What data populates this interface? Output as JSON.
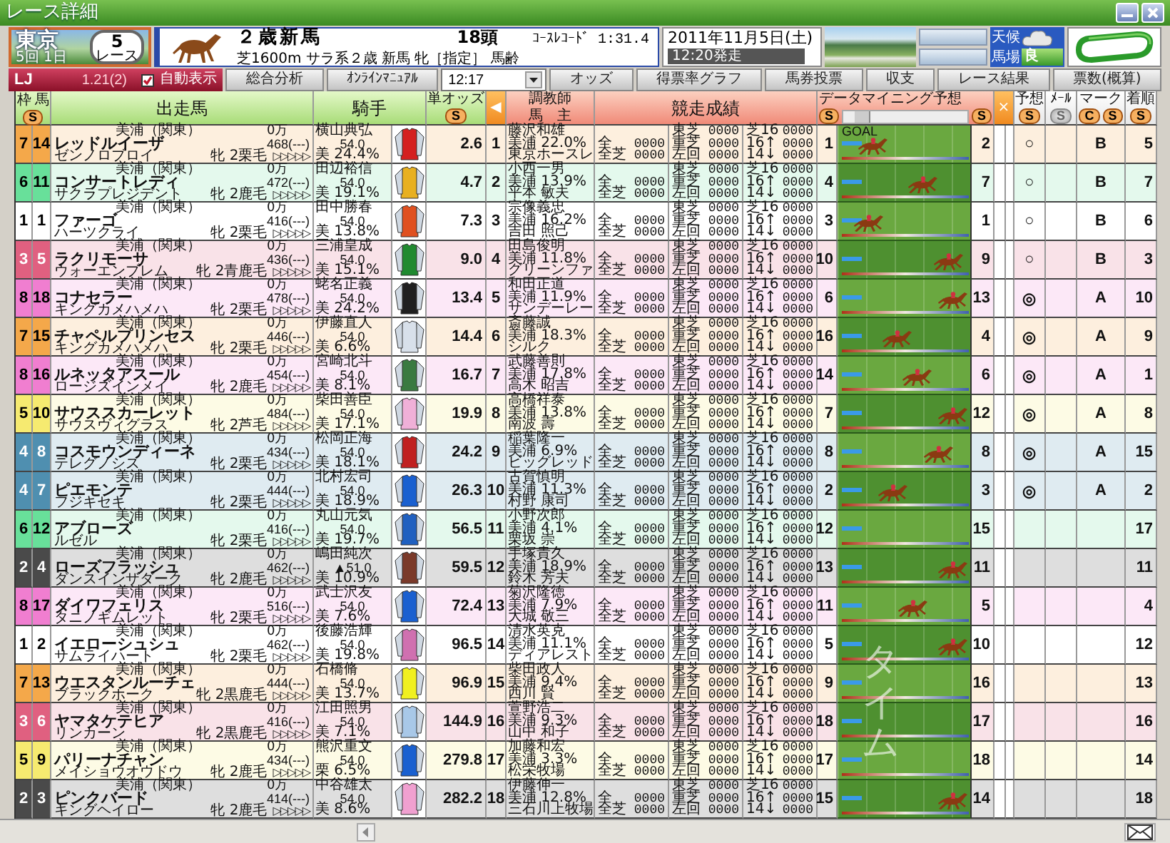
{
  "window": {
    "title": "レース詳細"
  },
  "venue": {
    "name": "東京",
    "meeting": "5回 1日",
    "race_no": "5",
    "race_label": "レース"
  },
  "race": {
    "name": "２歳新馬",
    "conditions": "芝1600m サラ系２歳 新馬 牝［指定］ 馬齢",
    "runners": "18頭",
    "course_record": "ｺｰｽﾚｺｰﾄﾞ 1:31.4",
    "date": "2011年11月5日(土)",
    "post_time": "12:20発走"
  },
  "conditions": {
    "weather_label": "天候",
    "track_label": "馬場",
    "track_state": "良"
  },
  "toolbar": {
    "badge": "LJ",
    "value": "1.21(2)",
    "auto_display": {
      "label": "自動表示",
      "checked": true
    },
    "items": [
      {
        "kind": "button",
        "label": "総合分析"
      },
      {
        "kind": "button",
        "label": "ｵﾝﾗｲﾝﾏﾆｭｱﾙ"
      },
      {
        "kind": "select",
        "label": "12:17"
      },
      {
        "kind": "button",
        "label": "オッズ"
      },
      {
        "kind": "button",
        "label": "得票率グラフ"
      },
      {
        "kind": "button",
        "label": "馬券投票"
      },
      {
        "kind": "button",
        "label": "収支"
      },
      {
        "kind": "button",
        "label": "レース結果"
      },
      {
        "kind": "button",
        "label": "票数(概算)"
      }
    ]
  },
  "header": {
    "frame": "枠",
    "number": "馬",
    "frame_sort": "S",
    "horse": "出走馬",
    "jockey": "騎手",
    "odds": {
      "label": "単オッズ",
      "sort": "S"
    },
    "collapse": "◀",
    "trainer": "調教師",
    "owner": "馬　主",
    "record": "競走成績",
    "mining": {
      "label": "データマイニング予想",
      "sort_left": "S",
      "sort_right": "S"
    },
    "close": "×",
    "forecast": {
      "label": "予想",
      "sort": "S",
      "disabled": false
    },
    "mail": {
      "label": "ﾒｰﾙ",
      "sort": "S",
      "disabled": true
    },
    "mark": {
      "label": "マーク",
      "buttons": [
        "C",
        "S"
      ]
    },
    "finish": {
      "label": "着順",
      "sort": "S",
      "disabled": false
    }
  },
  "goal_label": "GOAL",
  "track_overlay": "タイム",
  "rows": [
    {
      "frame": "7",
      "number": "14",
      "color": "#f4a84a",
      "stable": "美浦（関東）",
      "prize": "0万",
      "name": "レッドルイーザ",
      "weight": "468(---)",
      "sire": "ゼンノロブロイ",
      "sex_coat": "牝 2栗毛",
      "pace": "▷▷▷▷▷",
      "jockey": "横山典弘",
      "jockey_weight": "54.0",
      "jockey_rate": "美 24.4%",
      "silks": {
        "color": "#d42020"
      },
      "odds": "2.6",
      "popularity": "1",
      "trainer": "藤沢和雄",
      "trainer_rate": "美浦 22.0%",
      "owner": "東京ホースレ",
      "records": [
        [
          "全",
          "0000"
        ],
        [
          "全芝",
          "0000"
        ],
        [
          "東芝",
          "0000"
        ],
        [
          "重芝",
          "0000"
        ],
        [
          "左回",
          "0000"
        ],
        [
          "芝16",
          "0000"
        ],
        [
          "16↑",
          "0000"
        ],
        [
          "14↓",
          "0000"
        ]
      ],
      "mining_rank": "1",
      "level": 0.2,
      "predicted": "2",
      "forecast": "○",
      "mark": "B",
      "finish": "5"
    },
    {
      "frame": "6",
      "number": "11",
      "color": "#68e09a",
      "stable": "美浦（関東）",
      "prize": "0万",
      "name": "コンサートレディ",
      "weight": "472(---)",
      "sire": "サクラプレジデント",
      "sex_coat": "牝 2鹿毛",
      "pace": "▷▷▷▷▷",
      "jockey": "田辺裕信",
      "jockey_weight": "54.0",
      "jockey_rate": "美 19.1%",
      "silks": {
        "color": "#e8b020"
      },
      "odds": "4.7",
      "popularity": "2",
      "trainer": "小西一男",
      "trainer_rate": "美浦 13.9%",
      "owner": "平本 敏夫",
      "records": [
        [
          "全",
          "0000"
        ],
        [
          "全芝",
          "0000"
        ],
        [
          "東芝",
          "0000"
        ],
        [
          "重芝",
          "0000"
        ],
        [
          "左回",
          "0000"
        ],
        [
          "芝16",
          "0000"
        ],
        [
          "16↑",
          "0000"
        ],
        [
          "14↓",
          "0000"
        ]
      ],
      "mining_rank": "4",
      "level": 0.7,
      "predicted": "7",
      "forecast": "○",
      "mark": "B",
      "finish": "7"
    },
    {
      "frame": "1",
      "number": "1",
      "color": "#ffffff",
      "stable": "美浦（関東）",
      "prize": "0万",
      "name": "ファーゴ",
      "weight": "416(---)",
      "sire": "ハーツクライ",
      "sex_coat": "牝 2栗毛",
      "pace": "▷▷▷▷▷",
      "jockey": "田中勝春",
      "jockey_weight": "54.0",
      "jockey_rate": "美 13.8%",
      "silks": {
        "color": "#e05020"
      },
      "odds": "7.3",
      "popularity": "3",
      "trainer": "宗像義忠",
      "trainer_rate": "美浦 16.2%",
      "owner": "吉田 照己",
      "records": [
        [
          "全",
          "0000"
        ],
        [
          "全芝",
          "0000"
        ],
        [
          "東芝",
          "0000"
        ],
        [
          "重芝",
          "0000"
        ],
        [
          "左回",
          "0000"
        ],
        [
          "芝16",
          "0000"
        ],
        [
          "16↑",
          "0000"
        ],
        [
          "14↓",
          "0000"
        ]
      ],
      "mining_rank": "3",
      "level": 0.15,
      "predicted": "1",
      "forecast": "○",
      "mark": "B",
      "finish": "6"
    },
    {
      "frame": "3",
      "number": "5",
      "color": "#e06080",
      "stable": "美浦（関東）",
      "prize": "0万",
      "name": "ラクリモーサ",
      "weight": "436(---)",
      "sire": "ウォーエンブレム",
      "sex_coat": "牝 2青鹿毛",
      "pace": "▷▷▷▷▷",
      "jockey": "三浦皇成",
      "jockey_weight": "54.0",
      "jockey_rate": "美 15.1%",
      "silks": {
        "color": "#208a30"
      },
      "odds": "9.0",
      "popularity": "4",
      "trainer": "田島俊明",
      "trainer_rate": "美浦 11.8%",
      "owner": "グリーンファ",
      "records": [
        [
          "全",
          "0000"
        ],
        [
          "全芝",
          "0000"
        ],
        [
          "東芝",
          "0000"
        ],
        [
          "重芝",
          "0000"
        ],
        [
          "左回",
          "0000"
        ],
        [
          "芝16",
          "0000"
        ],
        [
          "16↑",
          "0000"
        ],
        [
          "14↓",
          "0000"
        ]
      ],
      "mining_rank": "10",
      "level": 0.95,
      "predicted": "9",
      "forecast": "○",
      "mark": "B",
      "finish": "3"
    },
    {
      "frame": "8",
      "number": "18",
      "color": "#f07ed0",
      "stable": "美浦（関東）",
      "prize": "0万",
      "name": "コナセラー",
      "weight": "478(---)",
      "sire": "キングカメハメハ",
      "sex_coat": "牝 2栗毛",
      "pace": "▷▷▷▷▷",
      "jockey": "蛯名正義",
      "jockey_weight": "54.0",
      "jockey_rate": "美 24.2%",
      "silks": {
        "color": "#202020"
      },
      "odds": "13.4",
      "popularity": "5",
      "trainer": "和田正道",
      "trainer_rate": "美浦 11.9%",
      "owner": "サンデーレー",
      "records": [
        [
          "全",
          "0000"
        ],
        [
          "全芝",
          "0000"
        ],
        [
          "東芝",
          "0000"
        ],
        [
          "重芝",
          "0000"
        ],
        [
          "左回",
          "0000"
        ],
        [
          "芝16",
          "0000"
        ],
        [
          "16↑",
          "0000"
        ],
        [
          "14↓",
          "0000"
        ]
      ],
      "mining_rank": "6",
      "level": 1,
      "predicted": "13",
      "forecast": "◎",
      "mark": "A",
      "finish": "10"
    },
    {
      "frame": "7",
      "number": "15",
      "color": "#f4a84a",
      "stable": "美浦（関東）",
      "prize": "0万",
      "name": "チャペルプリンセス",
      "weight": "446(---)",
      "sire": "キングカメハメハ",
      "sex_coat": "牝 2栗毛",
      "pace": "▷▷▷▷▷",
      "jockey": "伊藤直人",
      "jockey_weight": "54.0",
      "jockey_rate": "美 6.6%",
      "silks": {
        "color": "#d8e0ea"
      },
      "odds": "14.4",
      "popularity": "6",
      "trainer": "斎藤誠",
      "trainer_rate": "美浦 18.3%",
      "owner": "シルク",
      "records": [
        [
          "全",
          "0000"
        ],
        [
          "全芝",
          "0000"
        ],
        [
          "東芝",
          "0000"
        ],
        [
          "重芝",
          "0000"
        ],
        [
          "左回",
          "0000"
        ],
        [
          "芝16",
          "0000"
        ],
        [
          "16↑",
          "0000"
        ],
        [
          "14↓",
          "0000"
        ]
      ],
      "mining_rank": "16",
      "level": 0.45,
      "predicted": "4",
      "forecast": "◎",
      "mark": "A",
      "finish": "9"
    },
    {
      "frame": "8",
      "number": "16",
      "color": "#f07ed0",
      "stable": "美浦（関東）",
      "prize": "0万",
      "name": "ルネッタアスール",
      "weight": "454(---)",
      "sire": "ロージズインメイ",
      "sex_coat": "牝 2鹿毛",
      "pace": "▷▷▷▷▷",
      "jockey": "宮崎北斗",
      "jockey_weight": "54.0",
      "jockey_rate": "美 8.1%",
      "silks": {
        "color": "#3a7a40"
      },
      "odds": "16.7",
      "popularity": "7",
      "trainer": "武藤善則",
      "trainer_rate": "美浦 17.8%",
      "owner": "高木 昭吉",
      "records": [
        [
          "全",
          "0000"
        ],
        [
          "全芝",
          "0000"
        ],
        [
          "東芝",
          "0000"
        ],
        [
          "重芝",
          "0000"
        ],
        [
          "左回",
          "0000"
        ],
        [
          "芝16",
          "0000"
        ],
        [
          "16↑",
          "0000"
        ],
        [
          "14↓",
          "0000"
        ]
      ],
      "mining_rank": "14",
      "level": 0.65,
      "predicted": "6",
      "forecast": "◎",
      "mark": "A",
      "finish": "1"
    },
    {
      "frame": "5",
      "number": "10",
      "color": "#f6ea70",
      "stable": "美浦（関東）",
      "prize": "0万",
      "name": "サウススカーレット",
      "weight": "484(---)",
      "sire": "サウスヴィグラス",
      "sex_coat": "牝 2芦毛",
      "pace": "▷▷▷▷▷",
      "jockey": "柴田善臣",
      "jockey_weight": "54.0",
      "jockey_rate": "美 17.1%",
      "silks": {
        "color": "#f0b0d8"
      },
      "odds": "19.9",
      "popularity": "8",
      "trainer": "高橋祥泰",
      "trainer_rate": "美浦 13.8%",
      "owner": "南波 壽",
      "records": [
        [
          "全",
          "0000"
        ],
        [
          "全芝",
          "0000"
        ],
        [
          "東芝",
          "0000"
        ],
        [
          "重芝",
          "0000"
        ],
        [
          "左回",
          "0000"
        ],
        [
          "芝16",
          "0000"
        ],
        [
          "16↑",
          "0000"
        ],
        [
          "14↓",
          "0000"
        ]
      ],
      "mining_rank": "7",
      "level": 1,
      "predicted": "12",
      "forecast": "◎",
      "mark": "A",
      "finish": "8"
    },
    {
      "frame": "4",
      "number": "8",
      "color": "#4f8fb0",
      "stable": "美浦（関東）",
      "prize": "0万",
      "name": "コスモウンディーネ",
      "weight": "434(---)",
      "sire": "テレグノシス",
      "sex_coat": "牝 2栗毛",
      "pace": "▷▷▷▷▷",
      "jockey": "松岡正海",
      "jockey_weight": "54.0",
      "jockey_rate": "美 18.1%",
      "silks": {
        "color": "#c02020"
      },
      "odds": "24.2",
      "popularity": "9",
      "trainer": "稲葉隆一",
      "trainer_rate": "美浦 6.9%",
      "owner": "ビッグレッド",
      "records": [
        [
          "全",
          "0000"
        ],
        [
          "全芝",
          "0000"
        ],
        [
          "東芝",
          "0000"
        ],
        [
          "重芝",
          "0000"
        ],
        [
          "左回",
          "0000"
        ],
        [
          "芝16",
          "0000"
        ],
        [
          "16↑",
          "0000"
        ],
        [
          "14↓",
          "0000"
        ]
      ],
      "mining_rank": "8",
      "level": 0.85,
      "predicted": "8",
      "forecast": "◎",
      "mark": "A",
      "finish": "15"
    },
    {
      "frame": "4",
      "number": "7",
      "color": "#4f8fb0",
      "stable": "美浦（関東）",
      "prize": "0万",
      "name": "ピエモンテ",
      "weight": "444(---)",
      "sire": "フジキセキ",
      "sex_coat": "牝 2栗毛",
      "pace": "▷▷▷▷▷",
      "jockey": "北村宏司",
      "jockey_weight": "54.0",
      "jockey_rate": "美 18.9%",
      "silks": {
        "color": "#1a60d0"
      },
      "odds": "26.3",
      "popularity": "10",
      "trainer": "古賀慎明",
      "trainer_rate": "美浦 11.3%",
      "owner": "村野 康司",
      "records": [
        [
          "全",
          "0000"
        ],
        [
          "全芝",
          "0000"
        ],
        [
          "東芝",
          "0000"
        ],
        [
          "重芝",
          "0000"
        ],
        [
          "左回",
          "0000"
        ],
        [
          "芝16",
          "0000"
        ],
        [
          "16↑",
          "0000"
        ],
        [
          "14↓",
          "0000"
        ]
      ],
      "mining_rank": "2",
      "level": 0.4,
      "predicted": "3",
      "forecast": "◎",
      "mark": "A",
      "finish": "2"
    },
    {
      "frame": "6",
      "number": "12",
      "color": "#68e09a",
      "stable": "美浦（関東）",
      "prize": "0万",
      "name": "アブローズ",
      "weight": "416(---)",
      "sire": "ルゼル",
      "sex_coat": "牝 2栗毛",
      "pace": "▷▷▷▷▷",
      "jockey": "丸山元気",
      "jockey_weight": "54.0",
      "jockey_rate": "美 19.7%",
      "silks": {
        "color": "#2060c0"
      },
      "odds": "56.5",
      "popularity": "11",
      "trainer": "小野次郎",
      "trainer_rate": "美浦 4.1%",
      "owner": "栗坂 崇",
      "records": [
        [
          "全",
          "0000"
        ],
        [
          "全芝",
          "0000"
        ],
        [
          "東芝",
          "0000"
        ],
        [
          "重芝",
          "0000"
        ],
        [
          "左回",
          "0000"
        ],
        [
          "芝16",
          "0000"
        ],
        [
          "16↑",
          "0000"
        ],
        [
          "14↓",
          "0000"
        ]
      ],
      "mining_rank": "12",
      "predicted": "15",
      "finish": "17"
    },
    {
      "frame": "2",
      "number": "4",
      "color": "#4a4a4a",
      "stable": "美浦（関東）",
      "prize": "0万",
      "name": "ローズフラッシュ",
      "weight": "462(---)",
      "sire": "ダンスインザダーク",
      "sex_coat": "牝 2鹿毛",
      "pace": "▷▷▷▷▷",
      "jockey": "嶋田純次",
      "jockey_weight": "▲51.0",
      "jockey_rate": "美 10.9%",
      "silks": {
        "color": "#7a3a2a"
      },
      "odds": "59.5",
      "popularity": "12",
      "trainer": "手塚貴久",
      "trainer_rate": "美浦 18.9%",
      "owner": "鈴木 芳夫",
      "records": [
        [
          "全",
          "0000"
        ],
        [
          "全芝",
          "0000"
        ],
        [
          "東芝",
          "0000"
        ],
        [
          "重芝",
          "0000"
        ],
        [
          "左回",
          "0000"
        ],
        [
          "芝16",
          "0000"
        ],
        [
          "16↑",
          "0000"
        ],
        [
          "14↓",
          "0000"
        ]
      ],
      "mining_rank": "13",
      "level": 1,
      "predicted": "11",
      "finish": "11"
    },
    {
      "frame": "8",
      "number": "17",
      "color": "#f07ed0",
      "stable": "美浦（関東）",
      "prize": "0万",
      "name": "ダイワフェリス",
      "weight": "516(---)",
      "sire": "タニノギムレット",
      "sex_coat": "牝 2栗毛",
      "pace": "▷▷▷▷▷",
      "jockey": "武士沢友",
      "jockey_weight": "54.0",
      "jockey_rate": "美 7.6%",
      "silks": {
        "color": "#1a60d0"
      },
      "odds": "72.4",
      "popularity": "13",
      "trainer": "菊沢隆徳",
      "trainer_rate": "美浦 7.9%",
      "owner": "大城 敬三",
      "records": [
        [
          "全",
          "0000"
        ],
        [
          "全芝",
          "0000"
        ],
        [
          "東芝",
          "0000"
        ],
        [
          "重芝",
          "0000"
        ],
        [
          "左回",
          "0000"
        ],
        [
          "芝16",
          "0000"
        ],
        [
          "16↑",
          "0000"
        ],
        [
          "14↓",
          "0000"
        ]
      ],
      "mining_rank": "11",
      "level": 0.6,
      "predicted": "5",
      "finish": "4"
    },
    {
      "frame": "1",
      "number": "2",
      "color": "#ffffff",
      "stable": "美浦（関東）",
      "prize": "0万",
      "name": "イエローシュシュ",
      "weight": "462(---)",
      "sire": "サムライハート",
      "sex_coat": "牝 2栗毛",
      "pace": "▷▷▷▷▷",
      "jockey": "後藤浩輝",
      "jockey_weight": "54.0",
      "jockey_rate": "美 19.8%",
      "silks": {
        "color": "#d070b0"
      },
      "odds": "96.5",
      "popularity": "14",
      "trainer": "清水英克",
      "trainer_rate": "美浦 11.1%",
      "owner": "ディアレスト",
      "records": [
        [
          "全",
          "0000"
        ],
        [
          "全芝",
          "0000"
        ],
        [
          "東芝",
          "0000"
        ],
        [
          "重芝",
          "0000"
        ],
        [
          "左回",
          "0000"
        ],
        [
          "芝16",
          "0000"
        ],
        [
          "16↑",
          "0000"
        ],
        [
          "14↓",
          "0000"
        ]
      ],
      "mining_rank": "5",
      "level": 1,
      "predicted": "10",
      "finish": "12"
    },
    {
      "frame": "7",
      "number": "13",
      "color": "#f4a84a",
      "stable": "美浦（関東）",
      "prize": "0万",
      "name": "ウエスタンルーチェ",
      "weight": "444(---)",
      "sire": "ブラックホーク",
      "sex_coat": "牝 2黒鹿毛",
      "pace": "▷▷▷▷▷",
      "jockey": "石橋脩",
      "jockey_weight": "54.0",
      "jockey_rate": "美 13.7%",
      "silks": {
        "color": "#f0f020"
      },
      "odds": "96.9",
      "popularity": "15",
      "trainer": "柴田政人",
      "trainer_rate": "美浦 9.4%",
      "owner": "西川 賢",
      "records": [
        [
          "全",
          "0000"
        ],
        [
          "全芝",
          "0000"
        ],
        [
          "東芝",
          "0000"
        ],
        [
          "重芝",
          "0000"
        ],
        [
          "左回",
          "0000"
        ],
        [
          "芝16",
          "0000"
        ],
        [
          "16↑",
          "0000"
        ],
        [
          "14↓",
          "0000"
        ]
      ],
      "mining_rank": "9",
      "predicted": "16",
      "finish": "13"
    },
    {
      "frame": "3",
      "number": "6",
      "color": "#e06080",
      "stable": "美浦（関東）",
      "prize": "0万",
      "name": "ヤマタケテヒア",
      "weight": "416(---)",
      "sire": "リンカーン",
      "sex_coat": "牝 2黒鹿毛",
      "pace": "▷▷▷▷▷",
      "jockey": "江田照男",
      "jockey_weight": "54.0",
      "jockey_rate": "美 7.1%",
      "silks": {
        "color": "#a8c8e8"
      },
      "odds": "144.9",
      "popularity": "16",
      "trainer": "萱野浩二",
      "trainer_rate": "美浦 9.3%",
      "owner": "山中 和子",
      "records": [
        [
          "全",
          "0000"
        ],
        [
          "全芝",
          "0000"
        ],
        [
          "東芝",
          "0000"
        ],
        [
          "重芝",
          "0000"
        ],
        [
          "左回",
          "0000"
        ],
        [
          "芝16",
          "0000"
        ],
        [
          "16↑",
          "0000"
        ],
        [
          "14↓",
          "0000"
        ]
      ],
      "mining_rank": "18",
      "predicted": "17",
      "finish": "16"
    },
    {
      "frame": "5",
      "number": "9",
      "color": "#f6ea70",
      "stable": "美浦（関東）",
      "prize": "0万",
      "name": "パリーナチャン",
      "weight": "434(---)",
      "sire": "メイショウオウドウ",
      "sex_coat": "牝 2鹿毛",
      "pace": "▷▷▷▷▷",
      "jockey": "熊沢重文",
      "jockey_weight": "54.0",
      "jockey_rate": "栗 6.5%",
      "silks": {
        "color": "#1a60d0"
      },
      "odds": "279.8",
      "popularity": "17",
      "trainer": "加藤和宏",
      "trainer_rate": "美浦 3.3%",
      "owner": "松栄牧場",
      "records": [
        [
          "全",
          "0000"
        ],
        [
          "全芝",
          "0000"
        ],
        [
          "東芝",
          "0000"
        ],
        [
          "重芝",
          "0000"
        ],
        [
          "左回",
          "0000"
        ],
        [
          "芝16",
          "0000"
        ],
        [
          "16↑",
          "0000"
        ],
        [
          "14↓",
          "0000"
        ]
      ],
      "mining_rank": "17",
      "predicted": "18",
      "finish": "14"
    },
    {
      "frame": "2",
      "number": "3",
      "color": "#4a4a4a",
      "stable": "美浦（関東）",
      "prize": "0万",
      "name": "ピンクバード",
      "weight": "414(---)",
      "sire": "キングヘイロー",
      "sex_coat": "牝 2鹿毛",
      "pace": "▷▷▷▷▷",
      "jockey": "中谷雄太",
      "jockey_weight": "54.0",
      "jockey_rate": "美 8.6%",
      "silks": {
        "color": "#f0a0d0"
      },
      "odds": "282.2",
      "popularity": "18",
      "trainer": "伊藤伸一",
      "trainer_rate": "美浦 12.8%",
      "owner": "三石川上牧場",
      "records": [
        [
          "全",
          "0000"
        ],
        [
          "全芝",
          "0000"
        ],
        [
          "東芝",
          "0000"
        ],
        [
          "重芝",
          "0000"
        ],
        [
          "左回",
          "0000"
        ],
        [
          "芝16",
          "0000"
        ],
        [
          "16↑",
          "0000"
        ],
        [
          "14↓",
          "0000"
        ]
      ],
      "mining_rank": "15",
      "level": 1,
      "predicted": "14",
      "finish": "18"
    }
  ]
}
